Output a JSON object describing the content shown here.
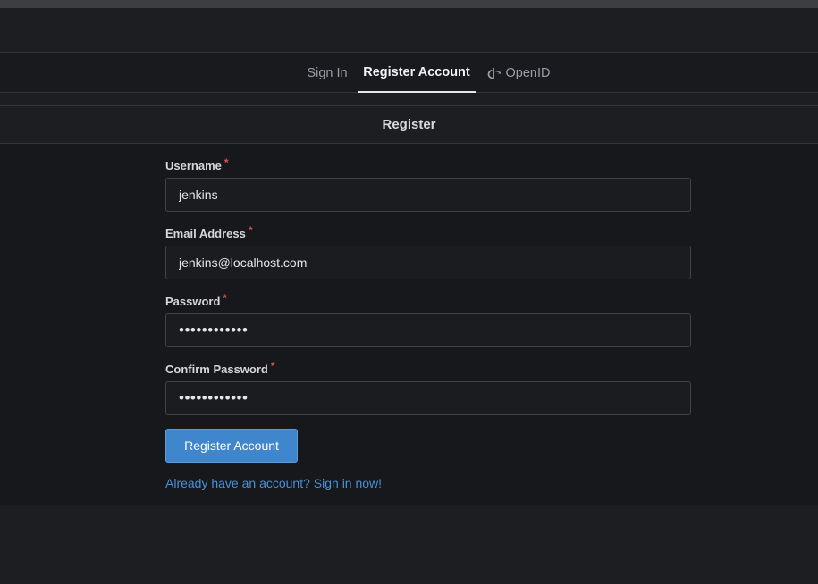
{
  "tabs": [
    {
      "label": "Sign In",
      "active": false
    },
    {
      "label": "Register Account",
      "active": true
    },
    {
      "label": "OpenID",
      "active": false,
      "icon": "openid-icon"
    }
  ],
  "form": {
    "title": "Register",
    "fields": {
      "username": {
        "label": "Username",
        "required_mark": "*",
        "value": "jenkins"
      },
      "email": {
        "label": "Email Address",
        "required_mark": "*",
        "value": "jenkins@localhost.com"
      },
      "password": {
        "label": "Password",
        "required_mark": "*",
        "value": "••••••••••••"
      },
      "confirm_password": {
        "label": "Confirm Password",
        "required_mark": "*",
        "value": "••••••••••••"
      }
    },
    "submit_label": "Register Account",
    "signin_link": "Already have an account? Sign in now!"
  },
  "colors": {
    "accent": "#3f86cc",
    "link": "#4a90d9",
    "required": "#d9534f",
    "background": "#1c1e22"
  }
}
